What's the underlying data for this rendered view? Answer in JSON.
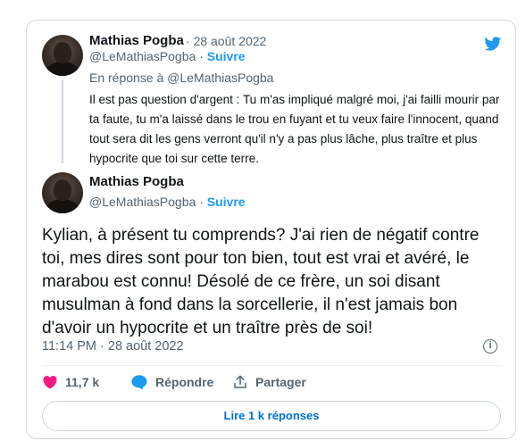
{
  "quoted_tweet": {
    "author_name": "Mathias Pogba",
    "separator": "·",
    "date": "28 août 2022",
    "handle": "@LeMathiasPogba",
    "follow_label": "Suivre",
    "reply_to": "En réponse à @LeMathiasPogba",
    "text": "Il est pas question d'argent : Tu m'as impliqué malgré moi, j'ai failli mourir par ta faute, tu m'a laissé dans le trou en fuyant et tu veux faire l'innocent, quand tout sera dit les gens verront qu'il n'y a pas plus lâche, plus traître et plus hypocrite que toi sur cette terre."
  },
  "main_tweet": {
    "author_name": "Mathias Pogba",
    "separator": "·",
    "handle": "@LeMathiasPogba",
    "follow_label": "Suivre",
    "text": "Kylian, à présent tu comprends? J'ai rien de négatif contre toi, mes dires sont pour ton bien, tout est vrai et avéré, le marabou est connu! Désolé de ce frère, un soi disant musulman à fond dans la sorcellerie, il n'est jamais bon d'avoir un hypocrite et un traître près de soi!",
    "timestamp": "11:14 PM · 28 août 2022"
  },
  "actions": {
    "like_count": "11,7 k",
    "reply_label": "Répondre",
    "share_label": "Partager",
    "read_replies_label": "Lire 1 k réponses"
  },
  "icons": {
    "brand": "twitter-bird-icon",
    "like": "heart-icon",
    "reply": "speech-bubble-icon",
    "share": "share-upload-icon",
    "info": "info-icon"
  },
  "colors": {
    "accent": "#1d9bf0",
    "link": "#006fd6",
    "like": "#f91880",
    "muted": "#536471",
    "border": "#cfd9de"
  }
}
